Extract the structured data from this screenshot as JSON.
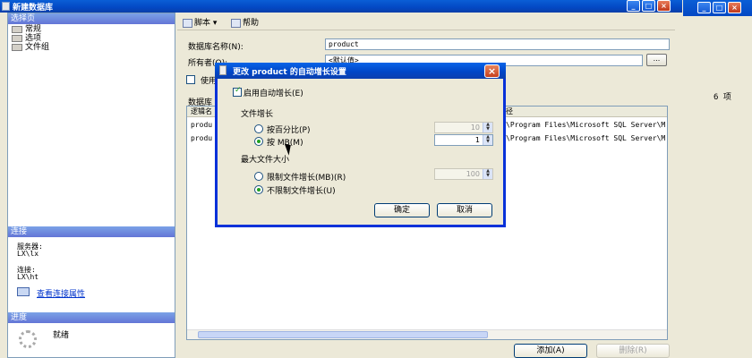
{
  "main_window": {
    "title": "新建数据库"
  },
  "left_panel": {
    "select_page_header": "选择页",
    "pages": [
      {
        "label": "常规"
      },
      {
        "label": "选项"
      },
      {
        "label": "文件组"
      }
    ],
    "connection_header": "连接",
    "server_label": "服务器:",
    "server_value": "LX\\lx",
    "connection_label": "连接:",
    "connection_value": "LX\\ht",
    "view_conn_props": "查看连接属性",
    "progress_header": "进度",
    "status": "就绪"
  },
  "toolbar": {
    "script_label": "脚本",
    "help_label": "帮助"
  },
  "form": {
    "db_name_label": "数据库名称(N):",
    "db_name_value": "product",
    "owner_label": "所有者(O):",
    "owner_value": "<默认值>",
    "browse_label": "...",
    "fulltext_label": "使用",
    "files_label": "数据库",
    "col_logical": "逻辑名",
    "col_path": "径",
    "rows": [
      {
        "name": "produ",
        "path": "\\Program Files\\Microsoft SQL Server\\M"
      },
      {
        "name": "produ",
        "path": "\\Program Files\\Microsoft SQL Server\\M"
      }
    ],
    "add_button": "添加(A)",
    "remove_button": "删除(R)"
  },
  "background_window": {
    "count": "6 项"
  },
  "dialog": {
    "title": "更改 product 的自动增长设置",
    "enable_autogrow": "启用自动增长(E)",
    "file_growth": "文件增长",
    "by_percent": "按百分比(P)",
    "percent_value": "10",
    "by_mb": "按 MB(M)",
    "mb_value": "1",
    "max_file_size": "最大文件大小",
    "limited": "限制文件增长(MB)(R)",
    "limited_value": "100",
    "unlimited": "不限制文件增长(U)",
    "ok": "确定",
    "cancel": "取消"
  }
}
